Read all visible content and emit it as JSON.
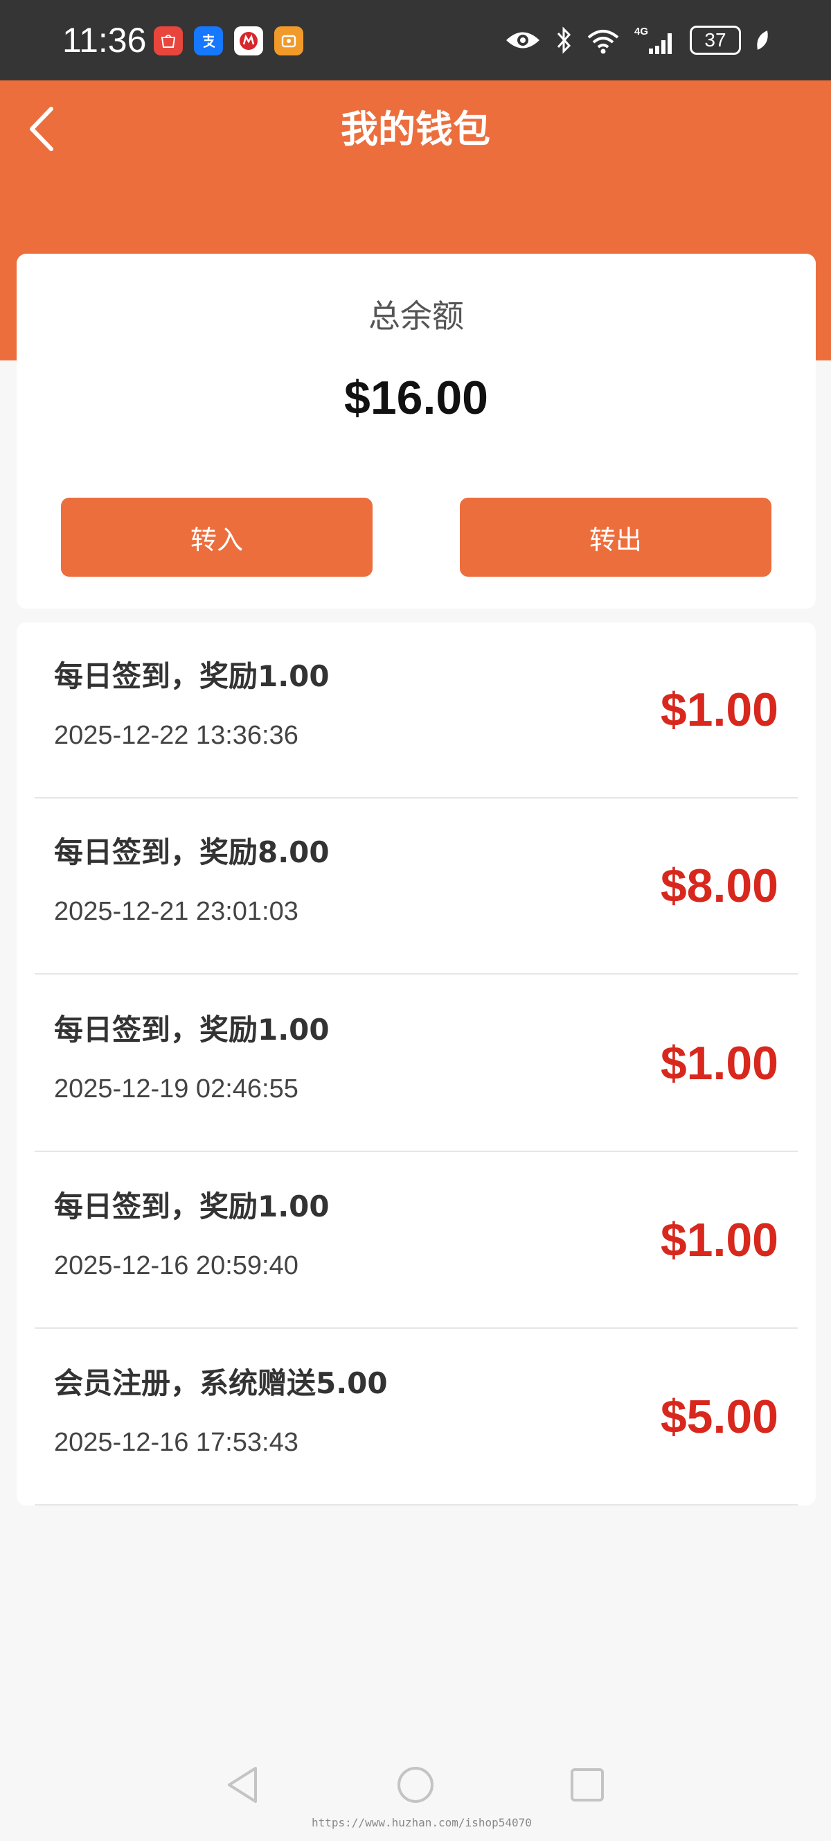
{
  "status_bar": {
    "time": "11:36",
    "network": "4G",
    "battery": "37"
  },
  "header": {
    "title": "我的钱包"
  },
  "balance": {
    "label": "总余额",
    "amount": "$16.00",
    "transfer_in_label": "转入",
    "transfer_out_label": "转出"
  },
  "records": [
    {
      "title": "每日签到，奖励1.00",
      "time": "2025-12-22 13:36:36",
      "amount": "$1.00"
    },
    {
      "title": "每日签到，奖励8.00",
      "time": "2025-12-21 23:01:03",
      "amount": "$8.00"
    },
    {
      "title": "每日签到，奖励1.00",
      "time": "2025-12-19 02:46:55",
      "amount": "$1.00"
    },
    {
      "title": "每日签到，奖励1.00",
      "time": "2025-12-16 20:59:40",
      "amount": "$1.00"
    },
    {
      "title": "会员注册，系统赠送5.00",
      "time": "2025-12-16 17:53:43",
      "amount": "$5.00"
    }
  ],
  "watermark": "https://www.huzhan.com/ishop54070",
  "colors": {
    "accent": "#ec6e3d",
    "amount_red": "#d8281e",
    "status_bar": "#353535",
    "page_bg": "#f7f7f7"
  },
  "icons": {
    "back": "back-arrow-icon",
    "nav_back": "triangle-back-icon",
    "nav_home": "circle-home-icon",
    "nav_recent": "square-recent-icon"
  }
}
